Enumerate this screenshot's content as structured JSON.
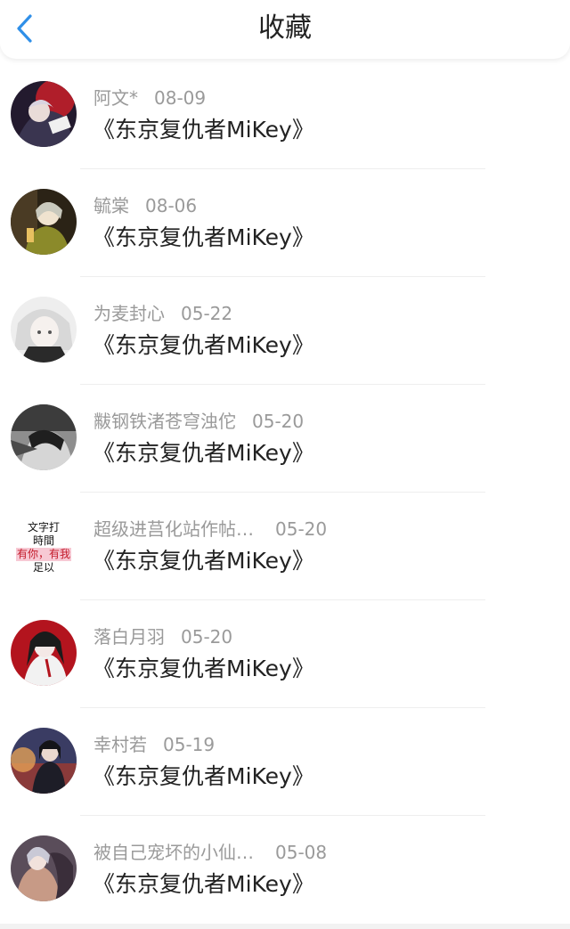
{
  "header": {
    "title": "收藏"
  },
  "colors": {
    "accent": "#2f8fe8",
    "meta_text": "#9a9a9a",
    "title_text": "#222222"
  },
  "favorites": [
    {
      "user": "阿文*",
      "date": "08-09",
      "title": "《东京复仇者MiKey》"
    },
    {
      "user": "毓棠",
      "date": "08-06",
      "title": "《东京复仇者MiKey》"
    },
    {
      "user": "为麦封心",
      "date": "05-22",
      "title": "《东京复仇者MiKey》"
    },
    {
      "user": "黻钢铁渚苍穹浊佗",
      "date": "05-20",
      "title": "《东京复仇者MiKey》"
    },
    {
      "user": "超级进莒化站作帖…",
      "date": "05-20",
      "title": "《东京复仇者MiKey》",
      "avatar_text": [
        "文字打",
        "時間",
        "有你，有我",
        "足以"
      ]
    },
    {
      "user": "落白月羽",
      "date": "05-20",
      "title": "《东京复仇者MiKey》"
    },
    {
      "user": "幸村若",
      "date": "05-19",
      "title": "《东京复仇者MiKey》"
    },
    {
      "user": "被自己宠坏的小仙…",
      "date": "05-08",
      "title": "《东京复仇者MiKey》"
    }
  ]
}
